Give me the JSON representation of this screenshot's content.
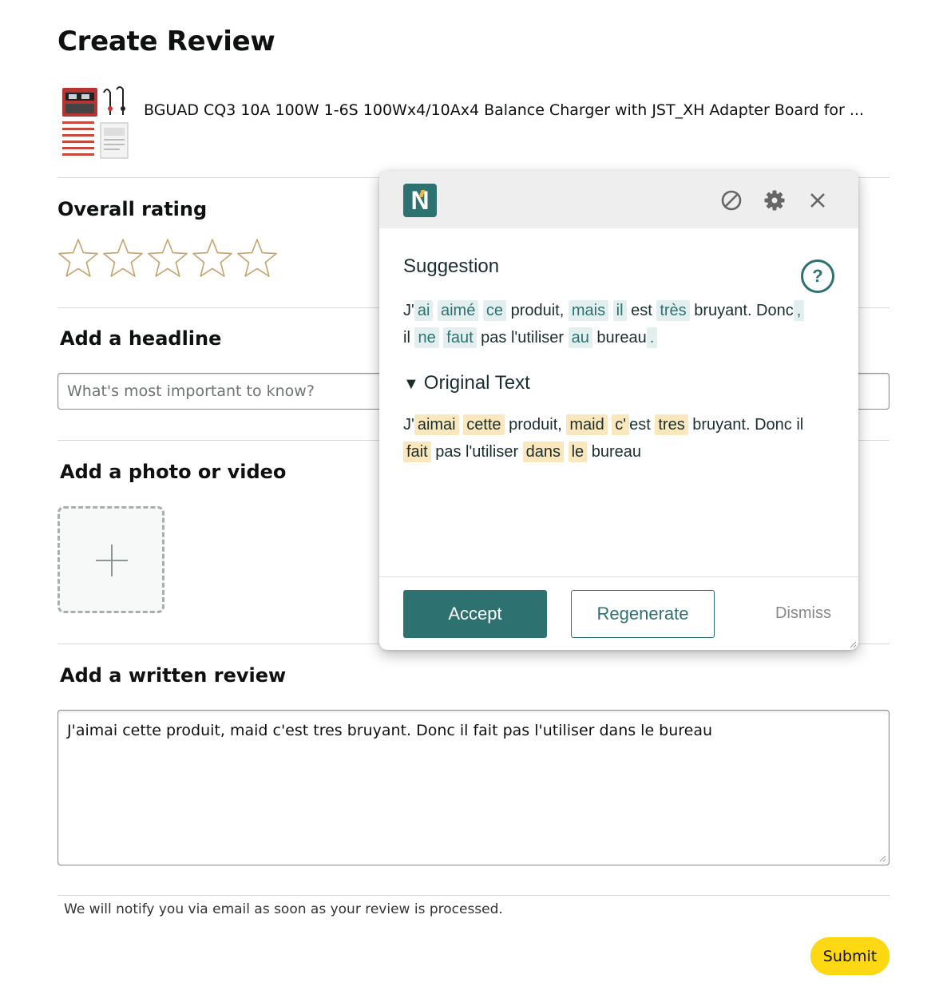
{
  "page": {
    "title": "Create Review"
  },
  "product": {
    "title": "BGUAD CQ3 10A 100W 1-6S 100Wx4/10Ax4 Balance Charger with JST_XH Adapter Board for ..."
  },
  "rating": {
    "label": "Overall rating",
    "selected": 0,
    "max": 5,
    "star_color": "#c7a16b"
  },
  "headline": {
    "label": "Add a headline",
    "placeholder": "What's most important to know?",
    "value": ""
  },
  "photo": {
    "label": "Add a photo or video"
  },
  "review": {
    "label": "Add a written review",
    "value": "J'aimai cette produit, maid c'est tres bruyant. Donc il fait pas l'utiliser dans le bureau"
  },
  "footer": {
    "notice": "We will notify you via email as soon as your review is processed.",
    "submit_label": "Submit"
  },
  "assistant": {
    "logo_letter": "N",
    "icons": [
      "disable-icon",
      "gear-icon",
      "close-icon"
    ],
    "suggestion_title": "Suggestion",
    "help_label": "?",
    "suggestion_lines": [
      [
        {
          "t": "J'"
        },
        {
          "t": "ai",
          "h": 1
        },
        {
          "t": " "
        },
        {
          "t": "aimé",
          "h": 1
        },
        {
          "t": " "
        },
        {
          "t": "ce",
          "h": 1
        },
        {
          "t": " produit, "
        },
        {
          "t": "mais",
          "h": 1
        },
        {
          "t": " "
        },
        {
          "t": "il",
          "h": 1
        },
        {
          "t": " est "
        },
        {
          "t": "très",
          "h": 1
        },
        {
          "t": " bruyant. Donc"
        },
        {
          "t": ",",
          "h": 1
        }
      ],
      [
        {
          "t": "il "
        },
        {
          "t": "ne",
          "h": 1
        },
        {
          "t": " "
        },
        {
          "t": "faut",
          "h": 1
        },
        {
          "t": " pas l'utiliser "
        },
        {
          "t": "au",
          "h": 1
        },
        {
          "t": " bureau"
        },
        {
          "t": ".",
          "h": 1
        }
      ]
    ],
    "original_title": "Original Text",
    "original_toggle": "▼",
    "original_lines": [
      [
        {
          "t": "J'"
        },
        {
          "t": "aimai",
          "h": 1
        },
        {
          "t": " "
        },
        {
          "t": "cette",
          "h": 1
        },
        {
          "t": " produit, "
        },
        {
          "t": "maid",
          "h": 1
        },
        {
          "t": " "
        },
        {
          "t": "c'",
          "h": 1
        },
        {
          "t": "est "
        },
        {
          "t": "tres",
          "h": 1
        },
        {
          "t": " bruyant. Donc il"
        }
      ],
      [
        {
          "t": "fait",
          "h": 1
        },
        {
          "t": " pas l'utiliser "
        },
        {
          "t": "dans",
          "h": 1
        },
        {
          "t": " "
        },
        {
          "t": "le",
          "h": 1
        },
        {
          "t": " bureau"
        }
      ]
    ],
    "accept_label": "Accept",
    "regenerate_label": "Regenerate",
    "dismiss_label": "Dismiss",
    "colors": {
      "accent": "#2d7171",
      "suggest_bg": "#e3efee",
      "original_bg": "#fbe7bd"
    }
  }
}
